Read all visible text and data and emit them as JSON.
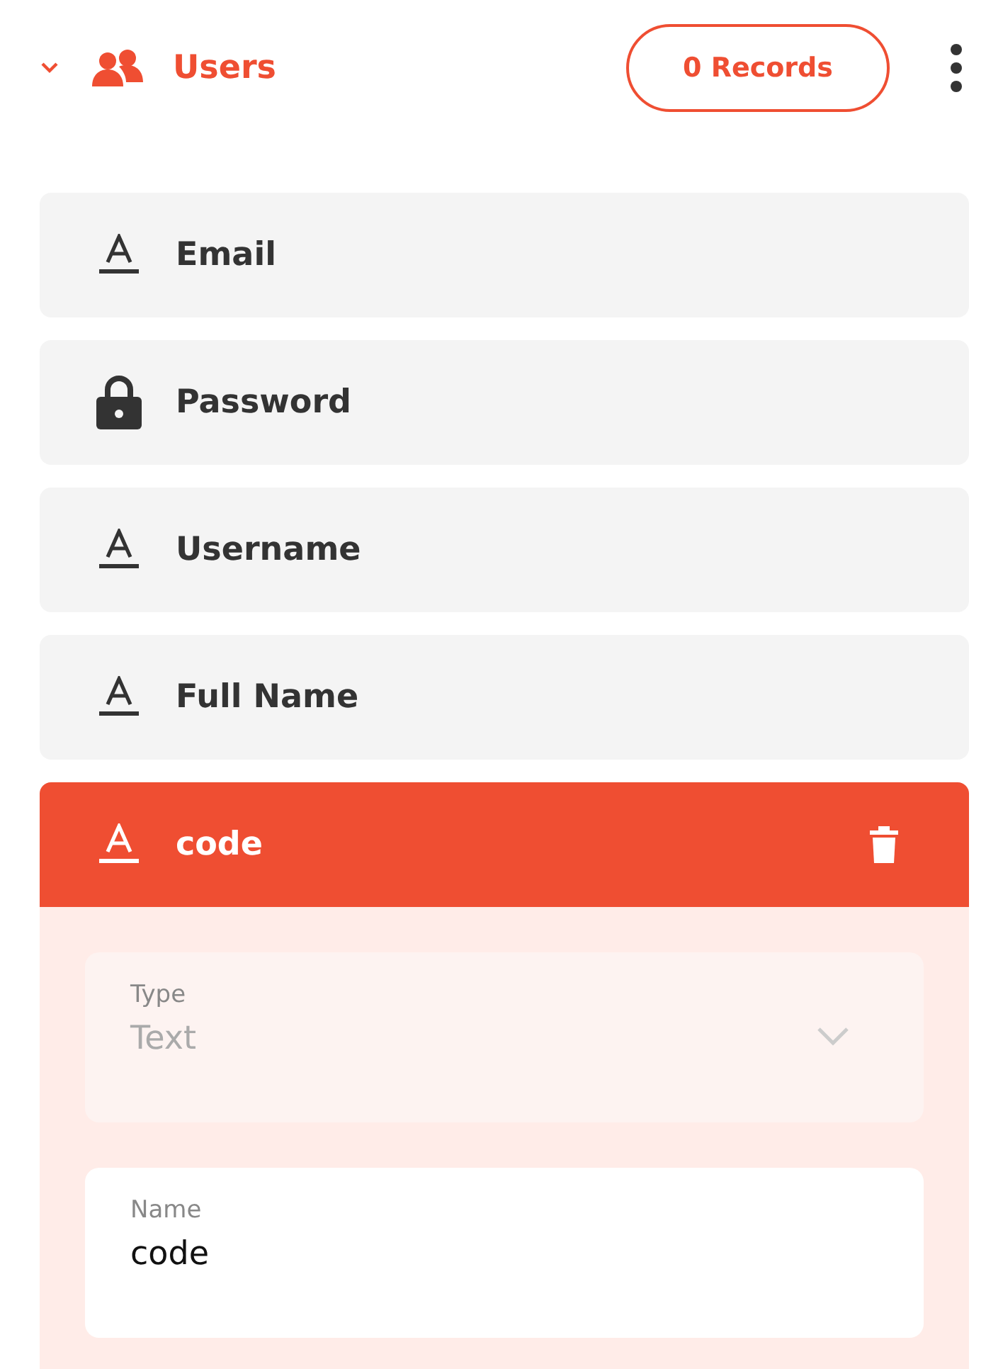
{
  "collection": {
    "title": "Users",
    "expanded": true,
    "records_button": "0 Records"
  },
  "fields": [
    {
      "label": "Email",
      "kind": "text",
      "selected": false
    },
    {
      "label": "Password",
      "kind": "password",
      "selected": false
    },
    {
      "label": "Username",
      "kind": "text",
      "selected": false
    },
    {
      "label": "Full Name",
      "kind": "text",
      "selected": false
    },
    {
      "label": "code",
      "kind": "text",
      "selected": true
    }
  ],
  "field_settings": [
    {
      "label": "Type",
      "value": "Text",
      "kind": "select",
      "disabled": true
    },
    {
      "label": "Name",
      "value": "code",
      "kind": "input",
      "disabled": false
    }
  ]
}
